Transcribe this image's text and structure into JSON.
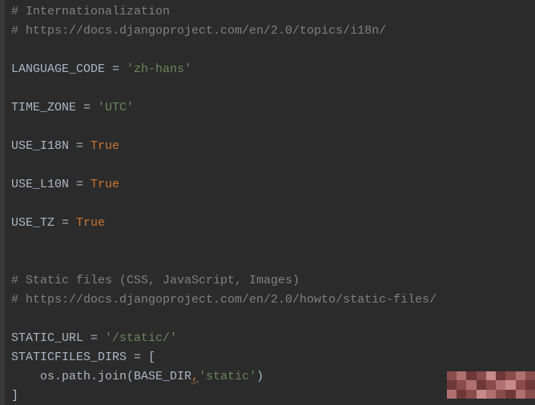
{
  "code": {
    "c1": "# Internationalization",
    "c2": "# https://docs.djangoproject.com/en/2.0/topics/i18n/",
    "lang_key": "LANGUAGE_CODE",
    "eq": " = ",
    "lang_val": "'zh-hans'",
    "tz_key": "TIME_ZONE",
    "tz_val": "'UTC'",
    "i18n_key": "USE_I18N",
    "l10n_key": "USE_L10N",
    "tz2_key": "USE_TZ",
    "true_kw": "True",
    "c3": "# Static files (CSS, JavaScript, Images)",
    "c4": "# https://docs.djangoproject.com/en/2.0/howto/static-files/",
    "static_url_key": "STATIC_URL",
    "static_url_val": "'/static/'",
    "static_dirs_key": "STATICFILES_DIRS",
    "open_bracket": " = [",
    "indent": "    ",
    "os_path": "os.path.join(BASE_DIR",
    "comma": ",",
    "static_str": "'static'",
    "close_paren": ")",
    "close_bracket": "]"
  }
}
